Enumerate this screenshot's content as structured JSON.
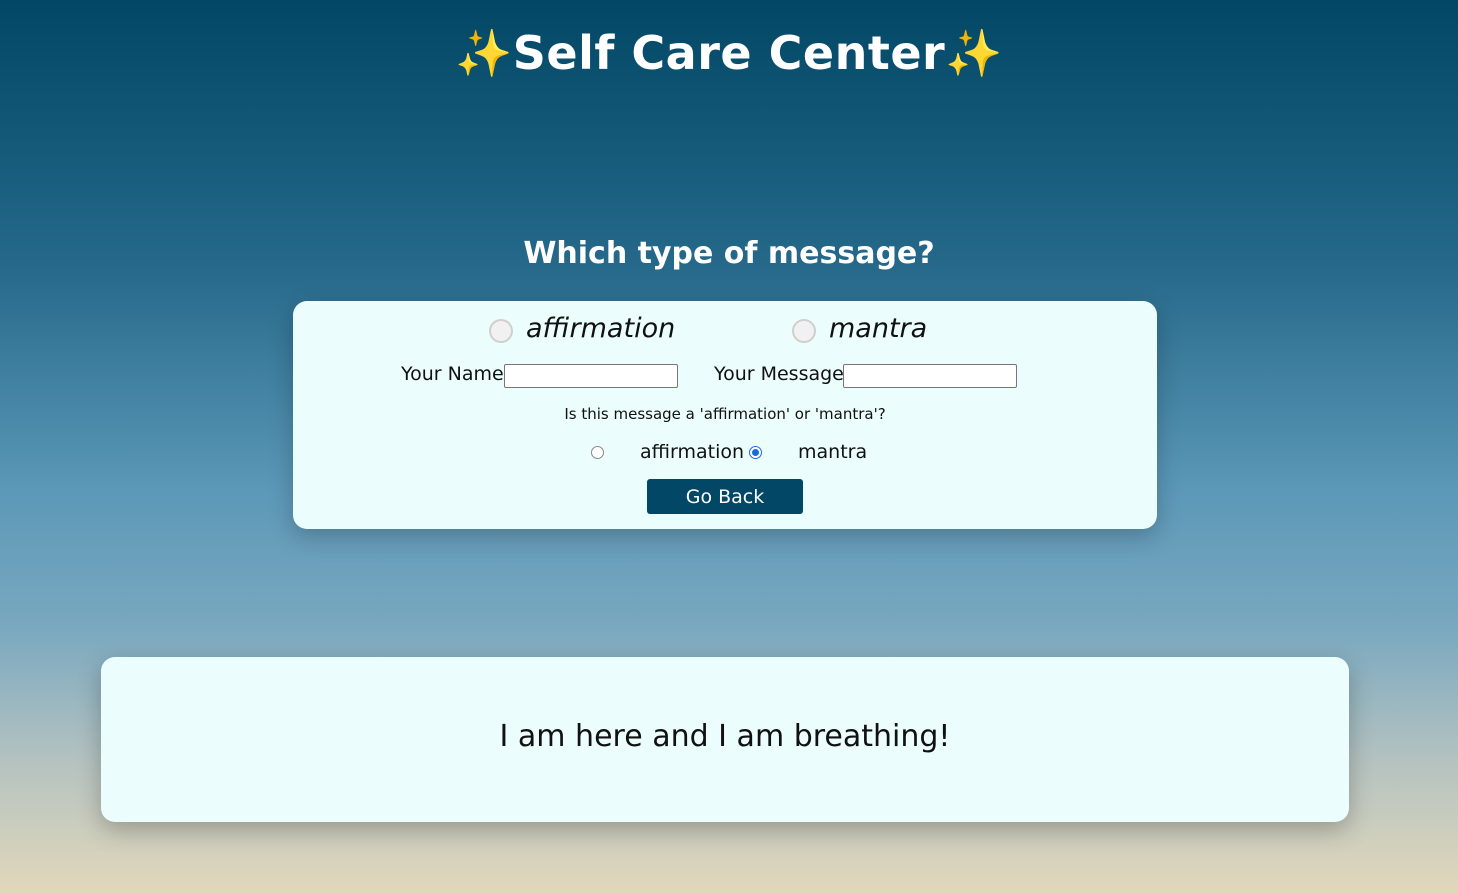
{
  "header": {
    "sparkle_left": "✨",
    "title": "Self Care Center",
    "sparkle_right": "✨"
  },
  "question_heading": "Which type of message?",
  "form": {
    "option_affirmation_label": "affirmation",
    "option_mantra_label": "mantra",
    "name_label": "Your Name",
    "name_value": "",
    "message_label": "Your Message",
    "message_value": "",
    "type_question": "Is this message a 'affirmation' or 'mantra'?",
    "type_affirmation_label": "affirmation",
    "type_mantra_label": "mantra",
    "selected_type": "mantra",
    "go_back_label": "Go Back"
  },
  "message_display": {
    "text": "I am here and I am breathing!"
  },
  "colors": {
    "accent": "#024766",
    "card_background": "#ebfefd",
    "sparkle": "#f7d34a"
  }
}
